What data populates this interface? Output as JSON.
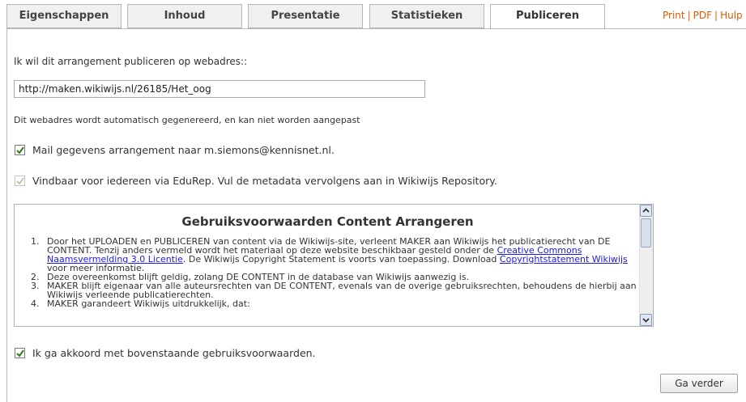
{
  "tabs": [
    {
      "label": "Eigenschappen"
    },
    {
      "label": "Inhoud"
    },
    {
      "label": "Presentatie"
    },
    {
      "label": "Statistieken"
    },
    {
      "label": "Publiceren",
      "active": true
    }
  ],
  "top_links": {
    "print": "Print",
    "pdf": "PDF",
    "help": "Hulp"
  },
  "publish": {
    "address_label": "Ik wil dit arrangement publiceren op webadres::",
    "address_value": "http://maken.wikiwijs.nl/26185/Het_oog",
    "address_note": "Dit webadres wordt automatisch gegenereerd, en kan niet worden aangepast",
    "mail_option": {
      "label": "Mail gegevens arrangement naar m.siemons@kennisnet.nl.",
      "checked": true
    },
    "edurep_option": {
      "label": "Vindbaar voor iedereen via EduRep. Vul de metadata vervolgens aan in Wikiwijs Repository.",
      "checked": true,
      "disabled": true
    }
  },
  "terms": {
    "title": "Gebruiksvoorwaarden Content Arrangeren",
    "item1": {
      "text_a": "Door het UPLOADEN en PUBLICEREN van content via de Wikiwijs-site, verleent MAKER aan Wikiwijs het publicatierecht van DE CONTENT. Tenzij anders vermeld wordt het materiaal op deze website beschikbaar gesteld onder de ",
      "link_a": "Creative Commons Naamsvermelding 3.0 Licentie",
      "text_b": ". De Wikiwijs Copyright Statement is voorts van toepassing. Download ",
      "link_b": "Copyrightstatement Wikiwijs",
      "text_c": " voor meer informatie."
    },
    "item2": "Deze overeenkomst blijft geldig, zolang DE CONTENT in de database van Wikiwijs aanwezig is.",
    "item3": "MAKER blijft eigenaar van alle auteursrechten van DE CONTENT, evenals van de overige gebruiksrechten, behoudens de hierbij aan Wikiwijs verleende publicatierechten.",
    "item4": "MAKER garandeert Wikiwijs uitdrukkelijk, dat:"
  },
  "agree_option": {
    "label": "Ik ga akkoord met bovenstaande gebruiksvoorwaarden.",
    "checked": true
  },
  "continue_button": "Ga verder",
  "colors": {
    "accent_link": "#e05a00",
    "hyperlink": "#1a1aee",
    "check": "#2e7d1a"
  }
}
